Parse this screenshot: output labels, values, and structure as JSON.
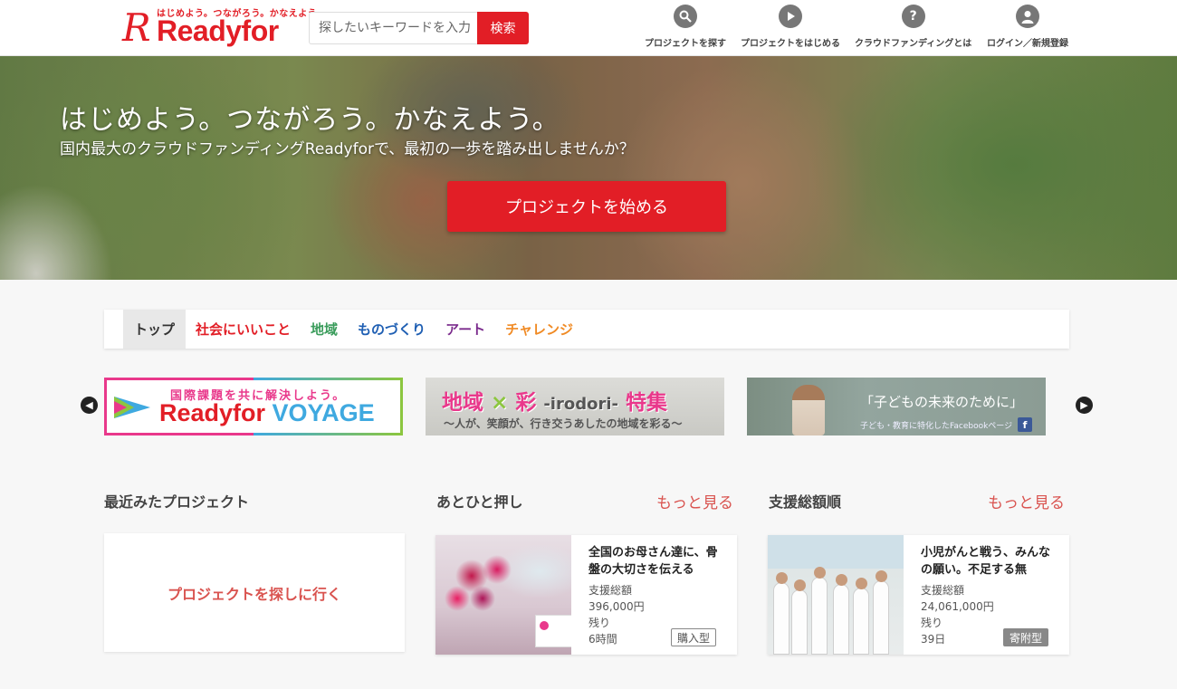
{
  "header": {
    "logo": {
      "tagline": "はじめよう。つながろう。かなえよう。",
      "mark": "R",
      "wordmark": "Readyfor"
    },
    "search": {
      "placeholder": "探したいキーワードを入力",
      "button": "検索"
    },
    "nav": [
      {
        "label": "プロジェクトを探す",
        "icon": "search-icon"
      },
      {
        "label": "プロジェクトをはじめる",
        "icon": "play-icon"
      },
      {
        "label": "クラウドファンディングとは",
        "icon": "question-icon"
      },
      {
        "label": "ログイン／新規登録",
        "icon": "user-icon"
      }
    ]
  },
  "hero": {
    "headline": "はじめよう。つながろう。かなえよう。",
    "subheadline": "国内最大のクラウドファンディングReadyforで、最初の一歩を踏み出しませんか？",
    "cta": "プロジェクトを始める"
  },
  "tabs": [
    {
      "label": "トップ",
      "color": "#333333",
      "active": true
    },
    {
      "label": "社会にいいこと",
      "color": "#e21e26"
    },
    {
      "label": "地域",
      "color": "#3a9c5b"
    },
    {
      "label": "ものづくり",
      "color": "#1f5fb3"
    },
    {
      "label": "アート",
      "color": "#7a2a8c"
    },
    {
      "label": "チャレンジ",
      "color": "#f08a24"
    }
  ],
  "banners": [
    {
      "line1": "国際課題を共に解決しよう。",
      "brand": "Readyfor",
      "brand2": "VOYAGE"
    },
    {
      "kanji1": "地域",
      "cross": "×",
      "kanji2": "彩",
      "roman": "-irodori-",
      "kanji3": "特集",
      "line2": "～人が、笑顔が、行き交うあしたの地域を彩る～"
    },
    {
      "line1": "「子どもの未来のために」",
      "line2": "子ども・教育に特化したFacebookページ",
      "fb": "f"
    }
  ],
  "carousel": {
    "prev_icon": "chevron-left-icon",
    "next_icon": "chevron-right-icon"
  },
  "sections": {
    "recent": {
      "title": "最近みたプロジェクト",
      "empty_link": "プロジェクトを探しに行く"
    },
    "almost": {
      "title": "あとひと押し",
      "more": "もっと見る",
      "project": {
        "title": "全国のお母さん達に、骨盤の大切さを伝える",
        "amount_label": "支援総額",
        "amount": "396,000円",
        "remaining_label": "残り",
        "remaining": "6時間",
        "type": "購入型"
      }
    },
    "top": {
      "title": "支援総額順",
      "more": "もっと見る",
      "project": {
        "title": "小児がんと戦う、みんなの願い。不足する無",
        "amount_label": "支援総額",
        "amount": "24,061,000円",
        "remaining_label": "残り",
        "remaining": "39日",
        "type": "寄附型"
      }
    }
  },
  "colors": {
    "brand": "#e21e26",
    "link": "#d9534f"
  }
}
